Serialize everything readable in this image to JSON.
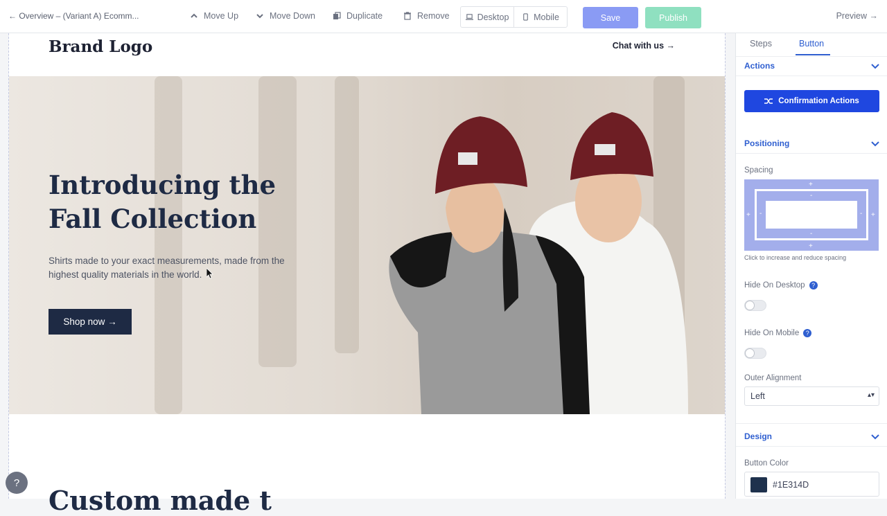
{
  "topbar": {
    "back_label": "← Overview – (Variant A) Ecomm...",
    "move_up": "Move Up",
    "move_down": "Move Down",
    "duplicate": "Duplicate",
    "remove": "Remove",
    "desktop": "Desktop",
    "mobile": "Mobile",
    "save": "Save",
    "publish": "Publish",
    "preview": "Preview →"
  },
  "page": {
    "brand": "Brand Logo",
    "chat": "Chat with us →",
    "headline": "Introducing the Fall Collection",
    "subtext": "Shirts made to your exact measurements, made from the highest quality materials in the world.",
    "cta": "Shop now →",
    "next_heading": "Custom made t"
  },
  "help_label": "?",
  "panel": {
    "tabs": [
      "Steps",
      "Button"
    ],
    "active_tab": "Button",
    "actions_title": "Actions",
    "confirm_button": "Confirmation Actions",
    "positioning_title": "Positioning",
    "spacing_label": "Spacing",
    "spacing_hint": "Click to increase and reduce spacing",
    "hide_desktop": "Hide On Desktop",
    "hide_mobile": "Hide On Mobile",
    "outer_alignment": "Outer Alignment",
    "alignment_value": "Left",
    "design_title": "Design",
    "button_color_label": "Button Color",
    "button_color_value": "#1E314D"
  },
  "colors": {
    "accent": "#2f5fd0",
    "confirm_bg": "#1f47e0",
    "save_bg": "#8a9bf4",
    "publish_bg": "#8fe0c0",
    "hero_dark": "#1e2a44"
  }
}
